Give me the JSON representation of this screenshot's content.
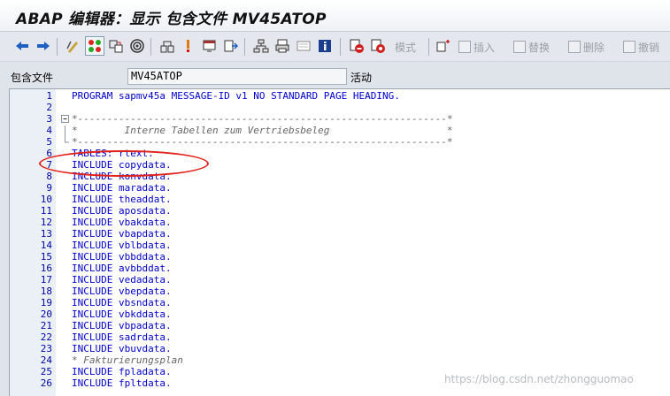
{
  "window": {
    "title": "ABAP 编辑器：显示 包含文件 MV45ATOP"
  },
  "toolbar": {
    "icons": [
      "back-arrow-icon",
      "forward-arrow-icon",
      "display-change-icon",
      "active-inactive-icon",
      "other-object-icon",
      "where-used-icon",
      "object-list-icon",
      "enhance-icon",
      "navigation-window-icon",
      "check-icon",
      "activate-icon",
      "hierarchy-icon",
      "pretty-printer-icon",
      "display-object-list-icon",
      "info-icon",
      "breakpoint-icon",
      "external-breakpoint-icon"
    ],
    "pattern_label": "模式",
    "insert_label": "插入",
    "replace_label": "替换",
    "delete_label": "删除",
    "undo_label": "撤销"
  },
  "info": {
    "label": "包含文件",
    "value": "MV45ATOP",
    "status": "活动"
  },
  "editor": {
    "lines": [
      {
        "n": "1",
        "text": "PROGRAM sapmv45a MESSAGE-ID v1 NO STANDARD PAGE HEADING.",
        "type": "code",
        "ctl": ""
      },
      {
        "n": "2",
        "text": "",
        "type": "code",
        "ctl": ""
      },
      {
        "n": "3",
        "text": "*---------------------------------------------------------------*",
        "type": "comment",
        "ctl": "minus"
      },
      {
        "n": "4",
        "text": "*        Interne Tabellen zum Vertriebsbeleg                    *",
        "type": "comment",
        "ctl": "bar"
      },
      {
        "n": "5",
        "text": "*---------------------------------------------------------------*",
        "type": "comment",
        "ctl": "end"
      },
      {
        "n": "6",
        "text": "TABLES: rtext.",
        "type": "code",
        "ctl": ""
      },
      {
        "n": "7",
        "text": "INCLUDE copydata.",
        "type": "code",
        "ctl": ""
      },
      {
        "n": "8",
        "text": "INCLUDE konvdata.",
        "type": "code",
        "ctl": ""
      },
      {
        "n": "9",
        "text": "INCLUDE maradata.",
        "type": "code",
        "ctl": ""
      },
      {
        "n": "10",
        "text": "INCLUDE theaddat.",
        "type": "code",
        "ctl": ""
      },
      {
        "n": "11",
        "text": "INCLUDE aposdata.",
        "type": "code",
        "ctl": ""
      },
      {
        "n": "12",
        "text": "INCLUDE vbakdata.",
        "type": "code",
        "ctl": ""
      },
      {
        "n": "13",
        "text": "INCLUDE vbapdata.",
        "type": "code",
        "ctl": ""
      },
      {
        "n": "14",
        "text": "INCLUDE vblbdata.",
        "type": "code",
        "ctl": ""
      },
      {
        "n": "15",
        "text": "INCLUDE vbbddata.",
        "type": "code",
        "ctl": ""
      },
      {
        "n": "16",
        "text": "INCLUDE avbbddat.",
        "type": "code",
        "ctl": ""
      },
      {
        "n": "17",
        "text": "INCLUDE vedadata.",
        "type": "code",
        "ctl": ""
      },
      {
        "n": "18",
        "text": "INCLUDE vbepdata.",
        "type": "code",
        "ctl": ""
      },
      {
        "n": "19",
        "text": "INCLUDE vbsndata.",
        "type": "code",
        "ctl": ""
      },
      {
        "n": "20",
        "text": "INCLUDE vbkddata.",
        "type": "code",
        "ctl": ""
      },
      {
        "n": "21",
        "text": "INCLUDE vbpadata.",
        "type": "code",
        "ctl": ""
      },
      {
        "n": "22",
        "text": "INCLUDE sadrdata.",
        "type": "code",
        "ctl": ""
      },
      {
        "n": "23",
        "text": "INCLUDE vbuvdata.",
        "type": "code",
        "ctl": ""
      },
      {
        "n": "24",
        "text": "* Fakturierungsplan",
        "type": "comment",
        "ctl": ""
      },
      {
        "n": "25",
        "text": "INCLUDE fpladata.",
        "type": "code",
        "ctl": ""
      },
      {
        "n": "26",
        "text": "INCLUDE fpltdata.",
        "type": "code",
        "ctl": ""
      }
    ]
  },
  "watermark": "https://blog.csdn.net/zhongguomao"
}
